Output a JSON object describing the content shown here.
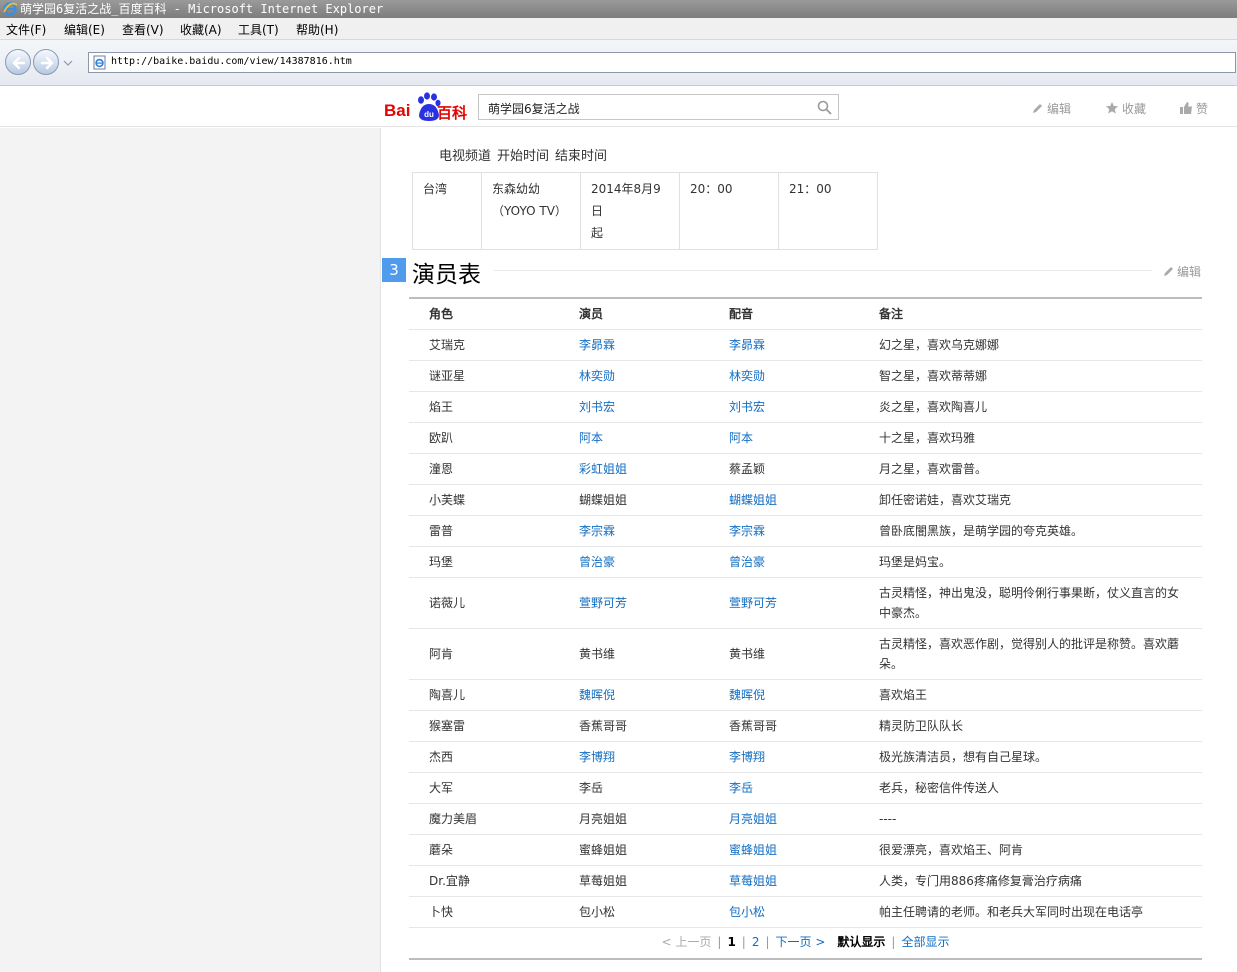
{
  "window": {
    "title": "萌学园6复活之战_百度百科 - Microsoft Internet Explorer"
  },
  "menu": [
    "文件(F)",
    "编辑(E)",
    "查看(V)",
    "收藏(A)",
    "工具(T)",
    "帮助(H)"
  ],
  "address": {
    "url": "http://baike.baidu.com/view/14387816.htm"
  },
  "baike": {
    "logo_text_bai": "Bai",
    "logo_text_du": "du",
    "logo_text_baike": "百科",
    "search_value": "萌学园6复活之战",
    "actions": {
      "edit": "编辑",
      "favorite": "收藏",
      "like": "赞"
    }
  },
  "broadcast": {
    "headers": [
      "电视频道",
      "开始时间",
      "结束时间"
    ],
    "row": {
      "region": "台湾",
      "channel_l1": "东森幼幼",
      "channel_l2": "（YOYO TV）",
      "date_l1": "2014年8月9日",
      "date_l2": "起",
      "start": "20：00",
      "end": "21：00"
    }
  },
  "section": {
    "number": "3",
    "title": "演员表",
    "edit": "编辑"
  },
  "cast": {
    "headers": [
      "角色",
      "演员",
      "配音",
      "备注"
    ],
    "rows": [
      {
        "role": "艾瑞克",
        "actor": "李昴霖",
        "actor_link": true,
        "voice": "李昴霖",
        "voice_link": true,
        "note": "幻之星，喜欢乌克娜娜"
      },
      {
        "role": "谜亚星",
        "actor": "林奕勋",
        "actor_link": true,
        "voice": "林奕勋",
        "voice_link": true,
        "note": "智之星，喜欢蒂蒂娜"
      },
      {
        "role": "焰王",
        "actor": "刘书宏",
        "actor_link": true,
        "voice": "刘书宏",
        "voice_link": true,
        "note": "炎之星，喜欢陶喜儿"
      },
      {
        "role": "欧趴",
        "actor": "阿本",
        "actor_link": true,
        "voice": "阿本",
        "voice_link": true,
        "note": "十之星，喜欢玛雅"
      },
      {
        "role": "潼恩",
        "actor": "彩虹姐姐",
        "actor_link": true,
        "voice": "蔡孟颖",
        "voice_link": false,
        "note": "月之星，喜欢雷普。"
      },
      {
        "role": "小芙蝶",
        "actor": "蝴蝶姐姐",
        "actor_link": false,
        "voice": "蝴蝶姐姐",
        "voice_link": true,
        "note": "卸任密诺娃，喜欢艾瑞克"
      },
      {
        "role": "雷普",
        "actor": "李宗霖",
        "actor_link": true,
        "voice": "李宗霖",
        "voice_link": true,
        "note": "曾卧底闇黑族，是萌学园的夸克英雄。"
      },
      {
        "role": "玛堡",
        "actor": "曾治豪",
        "actor_link": true,
        "voice": "曾治豪",
        "voice_link": true,
        "note": "玛堡是妈宝。"
      },
      {
        "role": "诺薇儿",
        "actor": "萱野可芳",
        "actor_link": true,
        "voice": "萱野可芳",
        "voice_link": true,
        "note": "古灵精怪，神出鬼没，聪明伶俐行事果断，仗义直言的女中豪杰。",
        "tall": true
      },
      {
        "role": "阿肯",
        "actor": "黄书维",
        "actor_link": false,
        "voice": "黄书维",
        "voice_link": false,
        "note": "古灵精怪，喜欢恶作剧，觉得别人的批评是称赞。喜欢蘑朵。",
        "tall": true
      },
      {
        "role": "陶喜儿",
        "actor": "魏晖倪",
        "actor_link": true,
        "voice": "魏晖倪",
        "voice_link": true,
        "note": "喜欢焰王"
      },
      {
        "role": "猴塞雷",
        "actor": "香蕉哥哥",
        "actor_link": false,
        "voice": "香蕉哥哥",
        "voice_link": false,
        "note": "精灵防卫队队长"
      },
      {
        "role": "杰西",
        "actor": "李博翔",
        "actor_link": true,
        "voice": "李博翔",
        "voice_link": true,
        "note": "极光族清洁员，想有自己星球。"
      },
      {
        "role": "大军",
        "actor": "李岳",
        "actor_link": false,
        "voice": "李岳",
        "voice_link": true,
        "note": "老兵，秘密信件传送人"
      },
      {
        "role": "魔力美眉",
        "actor": "月亮姐姐",
        "actor_link": false,
        "voice": "月亮姐姐",
        "voice_link": true,
        "note": "----"
      },
      {
        "role": "蘑朵",
        "actor": "蜜蜂姐姐",
        "actor_link": false,
        "voice": "蜜蜂姐姐",
        "voice_link": true,
        "note": "很爱漂亮，喜欢焰王、阿肯"
      },
      {
        "role": "Dr.宜静",
        "actor": "草莓姐姐",
        "actor_link": false,
        "voice": "草莓姐姐",
        "voice_link": true,
        "note": "人类，专门用886疼痛修复膏治疗病痛"
      },
      {
        "role": "卜快",
        "actor": "包小松",
        "actor_link": false,
        "voice": "包小松",
        "voice_link": true,
        "note": "帕主任聘请的老师。和老兵大军同时出现在电话亭"
      }
    ]
  },
  "pager": {
    "prev": "< 上一页",
    "page1": "1",
    "page2": "2",
    "next": "下一页 >",
    "default_view": "默认显示",
    "all_view": "全部显示"
  }
}
